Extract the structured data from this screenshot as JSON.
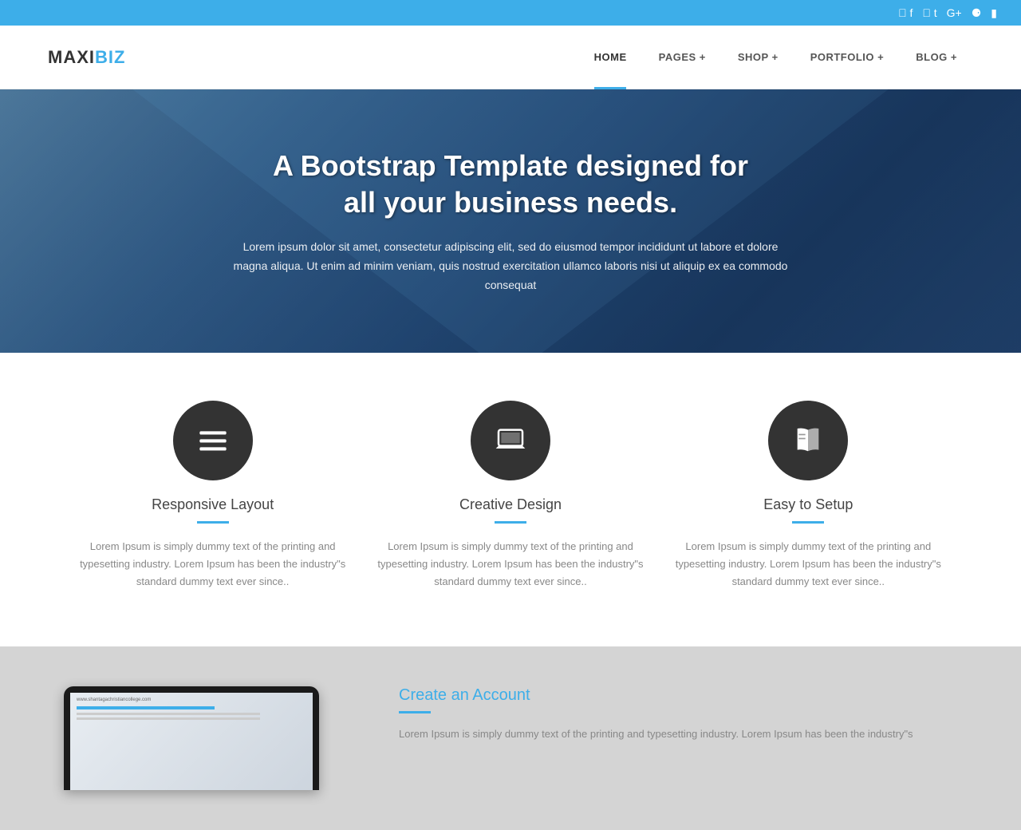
{
  "topbar": {
    "social_icons": [
      "facebook",
      "twitter",
      "google-plus",
      "dribbble",
      "rss"
    ]
  },
  "header": {
    "logo_maxi": "MAXI",
    "logo_biz": "BIZ",
    "nav_items": [
      {
        "label": "HOME",
        "active": true
      },
      {
        "label": "PAGES +",
        "active": false
      },
      {
        "label": "SHOP +",
        "active": false
      },
      {
        "label": "PORTFOLIO +",
        "active": false
      },
      {
        "label": "BLOG +",
        "active": false
      }
    ]
  },
  "hero": {
    "title": "A Bootstrap Template designed for\nall your business needs.",
    "subtitle": "Lorem ipsum dolor sit amet, consectetur adipiscing elit, sed do eiusmod tempor incididunt ut labore et dolore magna aliqua. Ut enim ad minim veniam, quis nostrud exercitation ullamco laboris nisi ut aliquip ex ea commodo consequat"
  },
  "features": [
    {
      "id": "responsive-layout",
      "icon": "menu",
      "title": "Responsive Layout",
      "text": "Lorem Ipsum is simply dummy text of the printing and typesetting industry. Lorem Ipsum has been the industry\"s standard dummy text ever since.."
    },
    {
      "id": "creative-design",
      "icon": "laptop",
      "title": "Creative Design",
      "text": "Lorem Ipsum is simply dummy text of the printing and typesetting industry. Lorem Ipsum has been the industry\"s standard dummy text ever since.."
    },
    {
      "id": "easy-setup",
      "icon": "book",
      "title": "Easy to Setup",
      "text": "Lorem Ipsum is simply dummy text of the printing and typesetting industry. Lorem Ipsum has been the industry\"s standard dummy text ever since.."
    }
  ],
  "bottom": {
    "url_text": "www.shantagachristiancollege.com",
    "title": "Create an Account",
    "description": "Lorem Ipsum is simply dummy text of the printing and typesetting industry. Lorem Ipsum has been the industry\"s"
  },
  "colors": {
    "accent": "#3daee9",
    "dark": "#333333",
    "text_muted": "#888888"
  }
}
